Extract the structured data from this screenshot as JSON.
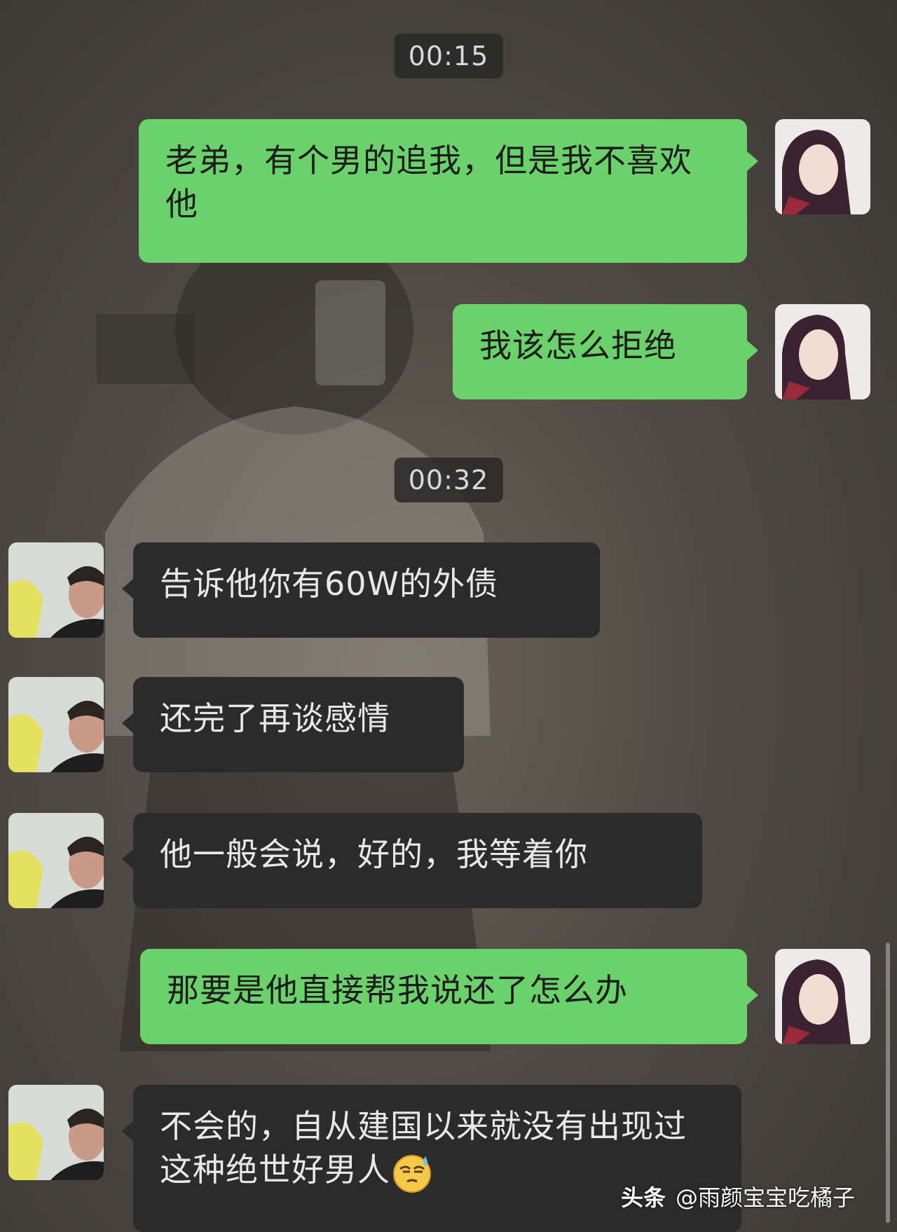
{
  "timestamps": [
    "00:15",
    "00:32"
  ],
  "messages": [
    {
      "side": "out",
      "text": "老弟，有个男的追我，但是我不喜欢他",
      "avatar": "woman-avatar"
    },
    {
      "side": "out",
      "text": "我该怎么拒绝",
      "avatar": "woman-avatar"
    },
    {
      "side": "in",
      "text": "告诉他你有60W的外债",
      "avatar": "man-avatar"
    },
    {
      "side": "in",
      "text": "还完了再谈感情",
      "avatar": "man-avatar"
    },
    {
      "side": "in",
      "text": "他一般会说，好的，我等着你",
      "avatar": "man-avatar"
    },
    {
      "side": "out",
      "text": "那要是他直接帮我说还了怎么办",
      "avatar": "woman-avatar"
    },
    {
      "side": "in",
      "text": "不会的，自从建国以来就没有出现过这种绝世好男人",
      "avatar": "man-avatar",
      "trailing_icon": "sweat-smile-emoji-icon"
    }
  ],
  "watermark": {
    "brand": "头条",
    "handle": "@雨颜宝宝吃橘子"
  },
  "colors": {
    "outgoing_bubble": "#6bd16a",
    "incoming_bubble": "#2b2b2b",
    "timestamp_bg": "#282828"
  }
}
